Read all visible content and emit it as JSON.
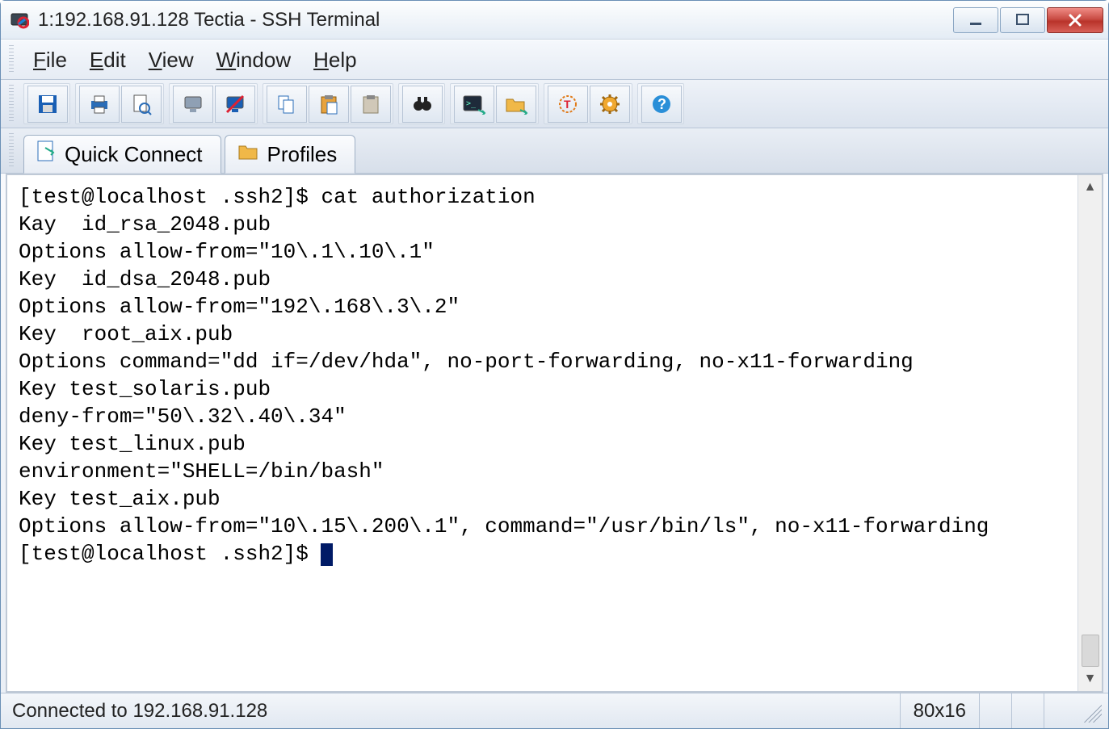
{
  "window": {
    "title": "1:192.168.91.128 Tectia - SSH Terminal"
  },
  "menus": {
    "file": "File",
    "edit": "Edit",
    "view": "View",
    "window": "Window",
    "help": "Help"
  },
  "toolbar": {
    "save": "save",
    "print": "print",
    "print_preview": "print-preview",
    "disconnect": "disconnect",
    "connect_bar": "connect-bar",
    "copy": "copy",
    "paste": "paste",
    "paste_selection": "paste-selection",
    "find": "find",
    "terminal": "terminal",
    "file_transfer": "file-transfer",
    "tunnels": "tunnels",
    "settings": "settings",
    "help": "help"
  },
  "tabs": {
    "quick_connect": "Quick Connect",
    "profiles": "Profiles"
  },
  "terminal": {
    "lines": [
      "[test@localhost .ssh2]$ cat authorization",
      "Kay  id_rsa_2048.pub",
      "Options allow-from=\"10\\.1\\.10\\.1\"",
      "Key  id_dsa_2048.pub",
      "Options allow-from=\"192\\.168\\.3\\.2\"",
      "Key  root_aix.pub",
      "Options command=\"dd if=/dev/hda\", no-port-forwarding, no-x11-forwarding",
      "Key test_solaris.pub",
      "deny-from=\"50\\.32\\.40\\.34\"",
      "Key test_linux.pub",
      "environment=\"SHELL=/bin/bash\"",
      "Key test_aix.pub",
      "Options allow-from=\"10\\.15\\.200\\.1\", command=\"/usr/bin/ls\", no-x11-forwarding"
    ],
    "prompt": "[test@localhost .ssh2]$ "
  },
  "status": {
    "connection": "Connected to 192.168.91.128",
    "size": "80x16"
  },
  "colors": {
    "accent": "#1a5fb4",
    "close": "#c94c44"
  }
}
